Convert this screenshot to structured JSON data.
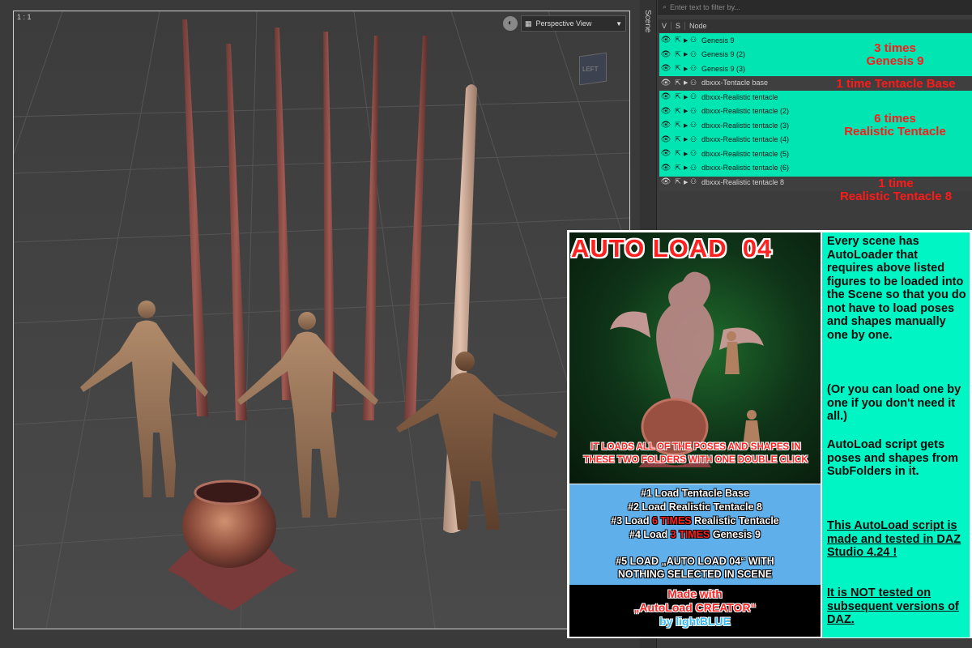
{
  "viewport": {
    "ratio_label": "1 : 1",
    "view_name": "Perspective View",
    "cube_label": "LEFT"
  },
  "scene": {
    "tab_label": "Scene",
    "filter_placeholder": "Enter text to filter by...",
    "columns": [
      "V",
      "S",
      "Node"
    ],
    "nodes": [
      {
        "label": "Genesis 9",
        "group": "green"
      },
      {
        "label": "Genesis 9 (2)",
        "group": "green"
      },
      {
        "label": "Genesis 9 (3)",
        "group": "green"
      },
      {
        "label": "dbxxx-Tentacle base",
        "group": "gray"
      },
      {
        "label": "dbxxx-Realistic tentacle",
        "group": "green"
      },
      {
        "label": "dbxxx-Realistic tentacle (2)",
        "group": "green"
      },
      {
        "label": "dbxxx-Realistic tentacle (3)",
        "group": "green"
      },
      {
        "label": "dbxxx-Realistic tentacle (4)",
        "group": "green"
      },
      {
        "label": "dbxxx-Realistic tentacle (5)",
        "group": "green"
      },
      {
        "label": "dbxxx-Realistic tentacle (6)",
        "group": "green"
      },
      {
        "label": "dbxxx-Realistic tentacle 8",
        "group": "gray"
      }
    ],
    "annotations": {
      "genesis_line1": "3 times",
      "genesis_line2": "Genesis 9",
      "base": "1 time Tentacle Base",
      "tentacle_line1": "6 times",
      "tentacle_line2": "Realistic Tentacle",
      "tentacle8_line1": "1 time",
      "tentacle8_line2": "Realistic Tentacle 8"
    }
  },
  "poster": {
    "title": "AUTO LOAD  04",
    "caption": "IT LOADS ALL OF THE POSES AND SHAPES IN THESE TWO FOLDERS WITH ONE DOUBLE CLICK",
    "steps": {
      "s1": "#1  Load Tentacle Base",
      "s2": "#2  Load Realistic Tentacle 8",
      "s3_pre": "#3 Load ",
      "s3_red": "6 TIMES",
      "s3_post": " Realistic Tentacle",
      "s4_pre": "#4 Load ",
      "s4_red": "3 TIMES",
      "s4_post": " Genesis 9",
      "s5_line1": "#5  LOAD „AUTO LOAD 04“ WITH",
      "s5_line2": "NOTHING SELECTED IN SCENE"
    },
    "made_line1": "Made with",
    "made_line2": "„AutoLoad CREATOR“",
    "made_line3": "by lightBLUE",
    "desc": {
      "p1": "Every scene has AutoLoader that requires above listed figures to be loaded into the Scene so that you do not have to load poses and shapes manually one by one.",
      "p2": "(Or you can load one by one if you don't need it all.)",
      "p3": "AutoLoad script gets poses and shapes from SubFolders in it.",
      "p4": "This AutoLoad script is made and tested in DAZ Studio 4.24 !",
      "p5": "It is NOT tested on subsequent versions of DAZ."
    }
  }
}
